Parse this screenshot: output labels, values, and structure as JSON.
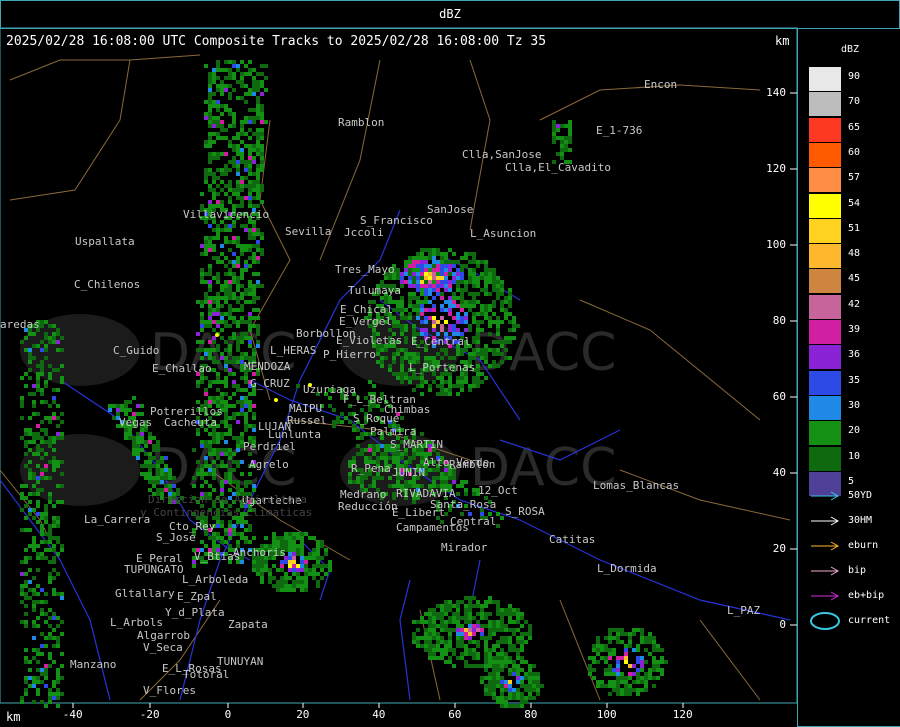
{
  "header": {
    "product": "dBZ"
  },
  "map": {
    "title": "2025/02/28 16:08:00 UTC Composite Tracks to 2025/02/28 16:08:00 Tz 35",
    "units_top": "km",
    "units_bottom": "km",
    "y_ticks": [
      "140",
      "120",
      "100",
      "80",
      "60",
      "40",
      "20",
      "0"
    ],
    "x_ticks": [
      "-40",
      "-20",
      "0",
      "20",
      "40",
      "60",
      "80",
      "100",
      "120"
    ],
    "watermark": [
      "DACC",
      "DACC",
      "DACC",
      "DACC"
    ],
    "places": [
      {
        "name": "Ramblon"
      },
      {
        "name": "Encon"
      },
      {
        "name": "E_1-736"
      },
      {
        "name": "Clla,SanJose"
      },
      {
        "name": "Clla,El_Cavadito"
      },
      {
        "name": "S_Francisco"
      },
      {
        "name": "SanJose"
      },
      {
        "name": "Jccoli"
      },
      {
        "name": "L_Asuncion"
      },
      {
        "name": "Villavicencio"
      },
      {
        "name": "Sevilla"
      },
      {
        "name": "Uspallata"
      },
      {
        "name": "Tres_Mayo"
      },
      {
        "name": "Tulumaya"
      },
      {
        "name": "C_Chilenos"
      },
      {
        "name": "E_Chical"
      },
      {
        "name": "E_Vergel"
      },
      {
        "name": "Borbollon"
      },
      {
        "name": "C_Guido"
      },
      {
        "name": "L_HERAS"
      },
      {
        "name": "E_Violetas"
      },
      {
        "name": "P_Hierro"
      },
      {
        "name": "E_Central"
      },
      {
        "name": "E_Challao"
      },
      {
        "name": "MENDOZA"
      },
      {
        "name": "G_CRUZ"
      },
      {
        "name": "Uzuriaga"
      },
      {
        "name": "L_Portenas"
      },
      {
        "name": "Potrerillos"
      },
      {
        "name": "Cacheuta"
      },
      {
        "name": "MAIPU"
      },
      {
        "name": "Russel"
      },
      {
        "name": "F_L_Beltran"
      },
      {
        "name": "Chimbas"
      },
      {
        "name": "Vegas"
      },
      {
        "name": "LUJAN"
      },
      {
        "name": "Lunlunta"
      },
      {
        "name": "S_Roque"
      },
      {
        "name": "Palmira"
      },
      {
        "name": "S_MARTIN"
      },
      {
        "name": "Perdriel"
      },
      {
        "name": "Agrelo"
      },
      {
        "name": "R_Pena"
      },
      {
        "name": "JUNIN"
      },
      {
        "name": "Alto_Verde"
      },
      {
        "name": "Ramblon"
      },
      {
        "name": "Ugarteche"
      },
      {
        "name": "Medrano"
      },
      {
        "name": "RIVADAVIA"
      },
      {
        "name": "12_Oct"
      },
      {
        "name": "Lomas_Blancas"
      },
      {
        "name": "La_Carrera"
      },
      {
        "name": "Reducción"
      },
      {
        "name": "E_Libert"
      },
      {
        "name": "Santa_Rosa"
      },
      {
        "name": "S_ROSA"
      },
      {
        "name": "Cto_Rey"
      },
      {
        "name": "Campamentos"
      },
      {
        "name": "Central"
      },
      {
        "name": "S_Jose"
      },
      {
        "name": "Anchoris"
      },
      {
        "name": "Catitas"
      },
      {
        "name": "E_Peral"
      },
      {
        "name": "V_Btias"
      },
      {
        "name": "Mirador"
      },
      {
        "name": "TUPUNGATO"
      },
      {
        "name": "L_Arboleda"
      },
      {
        "name": "L_Dormida"
      },
      {
        "name": "Gltallary"
      },
      {
        "name": "E_Zpal"
      },
      {
        "name": "Y_d_Plata"
      },
      {
        "name": "L_Arbols"
      },
      {
        "name": "Zapata"
      },
      {
        "name": "Algarrob"
      },
      {
        "name": "L_PAZ"
      },
      {
        "name": "V_Seca"
      },
      {
        "name": "Totoral"
      },
      {
        "name": "Manzano"
      },
      {
        "name": "E_L_Rosas"
      },
      {
        "name": "TUNUYAN"
      },
      {
        "name": "V_Flores"
      },
      {
        "name": "aredas"
      },
      {
        "name": "Direccion de Agricultura"
      },
      {
        "name": "y Contingencias Climaticas"
      }
    ]
  },
  "legend": {
    "title": "dBZ",
    "scale": [
      {
        "label": "90",
        "color": "#e8e8e8"
      },
      {
        "label": "70",
        "color": "#bdbdbd"
      },
      {
        "label": "65",
        "color": "#ff3822"
      },
      {
        "label": "60",
        "color": "#ff5a00"
      },
      {
        "label": "57",
        "color": "#ff8c44"
      },
      {
        "label": "54",
        "color": "#ffff00"
      },
      {
        "label": "51",
        "color": "#ffd21f"
      },
      {
        "label": "48",
        "color": "#ffb82e"
      },
      {
        "label": "45",
        "color": "#cd8540"
      },
      {
        "label": "42",
        "color": "#c8649c"
      },
      {
        "label": "39",
        "color": "#d21ea2"
      },
      {
        "label": "36",
        "color": "#8a23d6"
      },
      {
        "label": "35",
        "color": "#2d4ae6"
      },
      {
        "label": "30",
        "color": "#1f8ae6"
      },
      {
        "label": "20",
        "color": "#149114"
      },
      {
        "label": "10",
        "color": "#0f6a0f"
      },
      {
        "label": "5",
        "color": "#4f3f97"
      }
    ],
    "tracks": [
      {
        "label": "50YD",
        "color": "#39c9e0"
      },
      {
        "label": "30HM",
        "color": "#ffffff"
      },
      {
        "label": "eburn",
        "color": "#ffb82e"
      },
      {
        "label": "bip",
        "color": "#f7a8cf"
      },
      {
        "label": "eb+bip",
        "color": "#d02ed6"
      },
      {
        "label": "current",
        "color": "#39c9e0"
      }
    ]
  }
}
